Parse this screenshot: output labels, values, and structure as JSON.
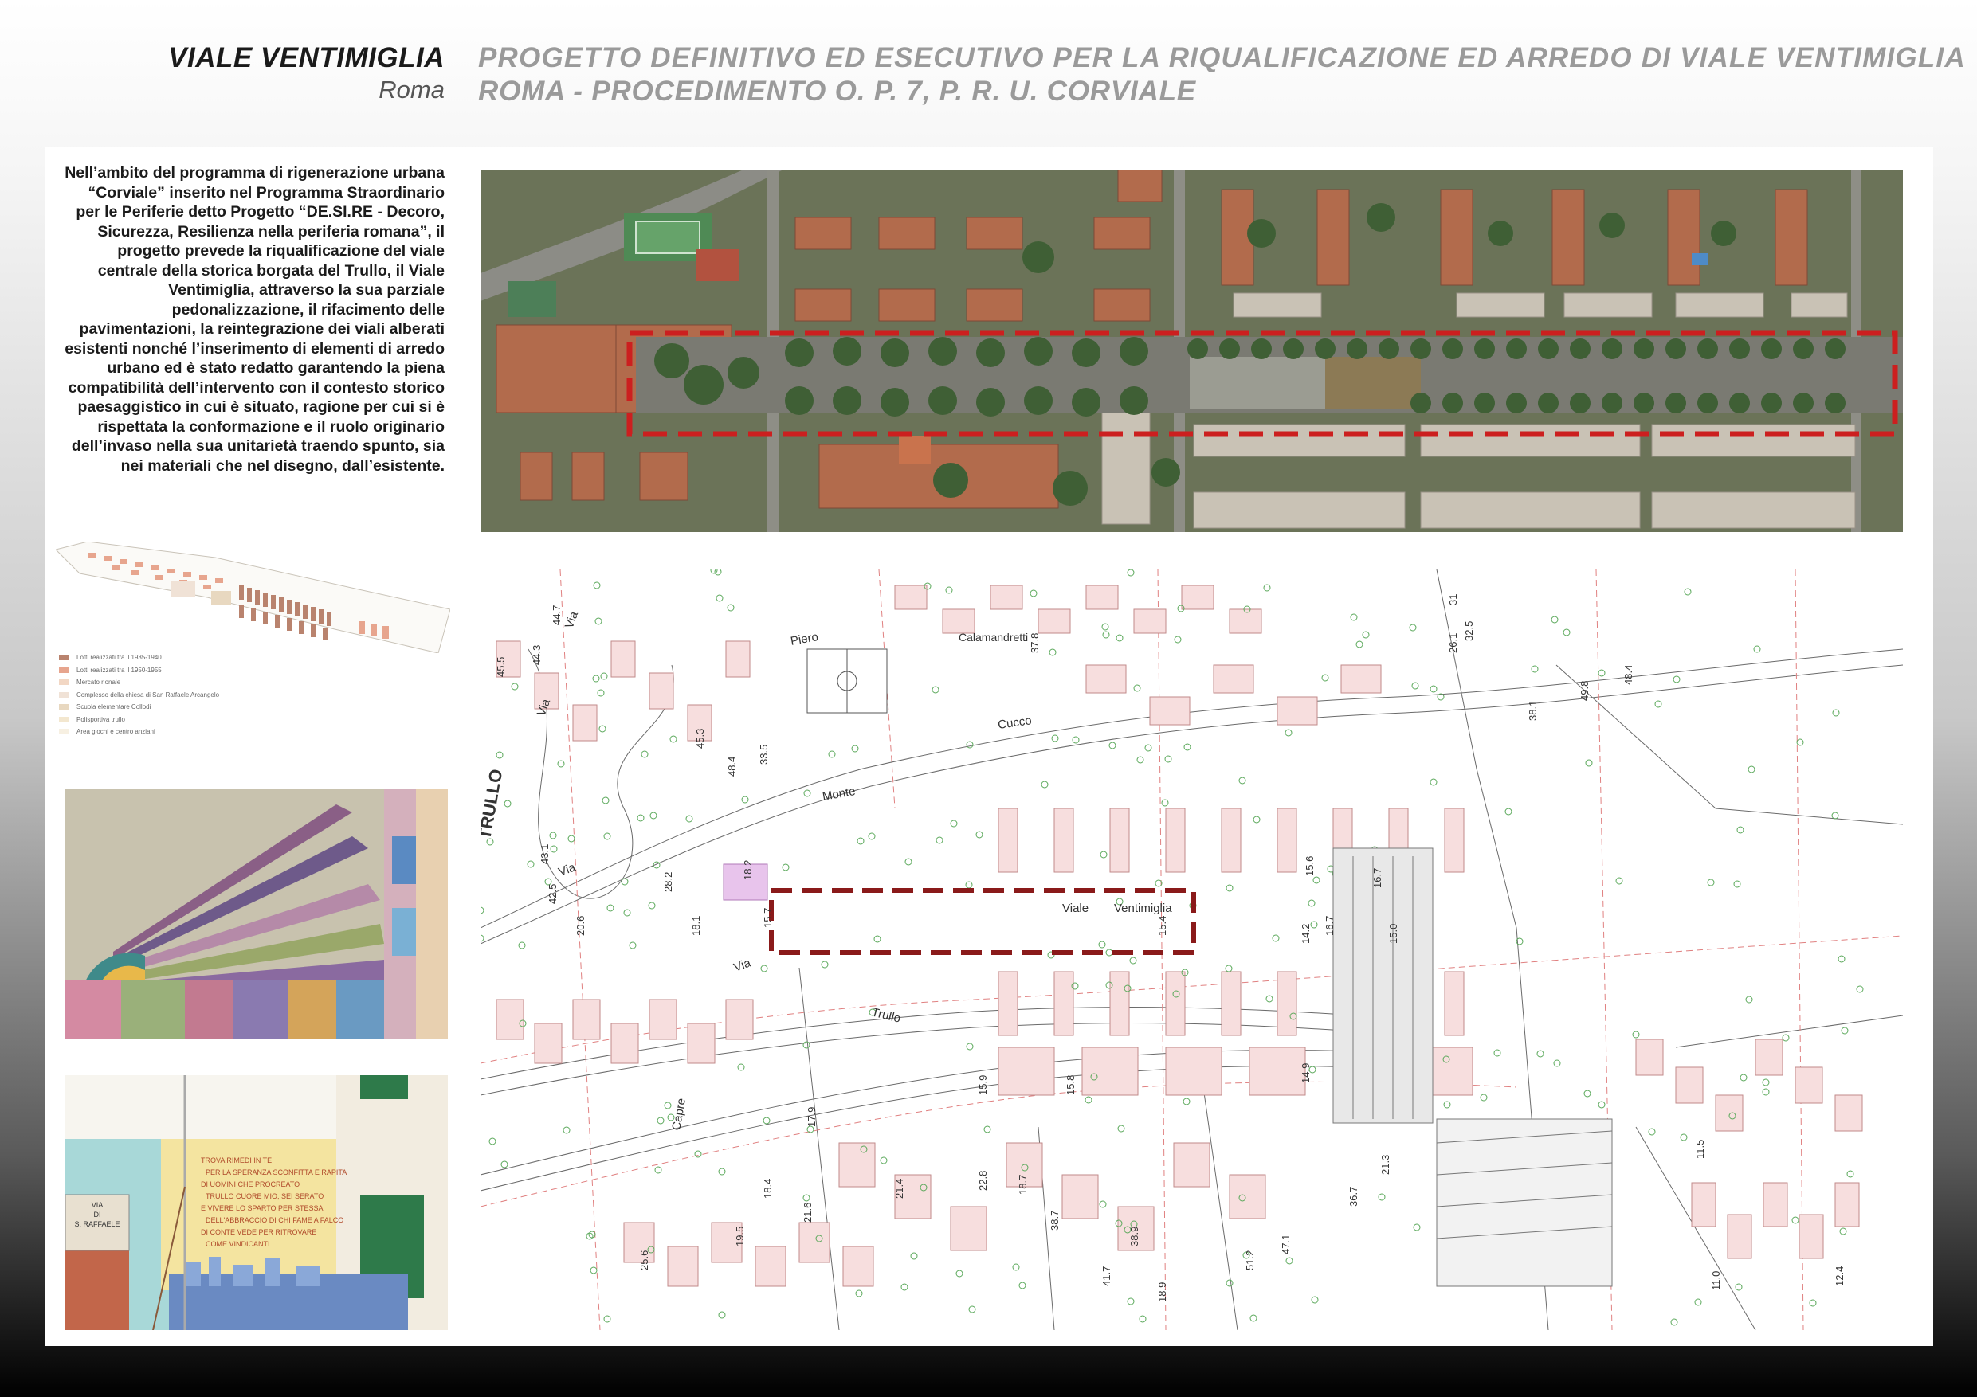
{
  "header": {
    "title": "VIALE VENTIMIGLIA",
    "city": "Roma",
    "project_line1": "PROGETTO DEFINITIVO ED ESECUTIVO PER LA RIQUALIFICAZIONE ED ARREDO DI VIALE VENTIMIGLIA",
    "project_line2": "ROMA - PROCEDIMENTO O. P. 7, P. R. U. CORVIALE"
  },
  "intro": {
    "text": "Nell’ambito del programma di rigenerazione urbana “Corviale” inserito nel Programma Straordinario per le Periferie detto Progetto “DE.SI.RE - Decoro, Sicurezza, Resilienza nella periferia romana”, il progetto prevede la riqualificazione del viale centrale della storica borgata del Trullo, il Viale Ventimiglia, attraverso la sua parziale pedonalizzazione, il rifacimento delle pavimentazioni, la reintegrazione dei viali alberati esistenti nonché l’inserimento di elementi di arredo urbano ed è stato redatto garantendo la piena compatibilità dell’intervento con il contesto storico paesaggistico in cui è situato, ragione per cui si è rispettata la conformazione e il ruolo originario dell’invaso nella sua unitarietà traendo spunto, sia nei materiali che nel disegno, dall’esistente."
  },
  "legend": {
    "items": [
      {
        "label": "Lotti realizzati tra il 1935-1940",
        "color": "#b9836e"
      },
      {
        "label": "Lotti realizzati tra il 1950-1955",
        "color": "#e7a58e"
      },
      {
        "label": "Mercato rionale",
        "color": "#f2d7c4"
      },
      {
        "label": "Complesso della chiesa di San Raffaele Arcangelo",
        "color": "#f0e2d6"
      },
      {
        "label": "Scuola elementare Collodi",
        "color": "#e8d8c0"
      },
      {
        "label": "Polisportiva trullo",
        "color": "#f3e7cf"
      },
      {
        "label": "Area giochi e centro anziani",
        "color": "#f7f0e2"
      }
    ]
  },
  "photo2": {
    "sign_line1": "VIA",
    "sign_line2": "DI",
    "sign_line3": "S. RAFFAELE",
    "poem": [
      "TROVA RIMEDI IN TE",
      "PER LA SPERANZA SCONFITTA E RAPITA",
      "DI UOMINI CHE PROCREATO",
      "TRULLO CUORE MIO, SEI SERATO",
      "E VIVERE LO SPARTO PER STESSA",
      "DELL'ABBRACCIO DI CHI FAME A FALCO",
      "DI CONTE VEDE PER RITROVARE",
      "COME VINDICANTI"
    ]
  },
  "plan": {
    "street_labels": [
      "TRULLO",
      "Via",
      "Monte",
      "Cucco",
      "Via",
      "Piero",
      "Calamandretti",
      "Via",
      "Viale",
      "Ventimiglia",
      "Trullo",
      "Capre",
      "Via"
    ],
    "spot_heights": [
      "45.5",
      "44.3",
      "44.7",
      "37.8",
      "45.3",
      "48.4",
      "33.5",
      "43.1",
      "42.5",
      "28.2",
      "20.6",
      "18.1",
      "18.2",
      "15.7",
      "15.4",
      "14.2",
      "15.6",
      "16.7",
      "15.0",
      "26.1",
      "32.5",
      "31",
      "38.1",
      "49.8",
      "48.4",
      "16.7",
      "15.9",
      "15.8",
      "14.9",
      "17.9",
      "18.4",
      "19.5",
      "21.6",
      "25.6",
      "21.4",
      "22.8",
      "18.7",
      "38.7",
      "38.9",
      "41.7",
      "51.2",
      "47.1",
      "36.7",
      "21.3",
      "11.5",
      "11.0",
      "12.4",
      "18.9"
    ]
  }
}
